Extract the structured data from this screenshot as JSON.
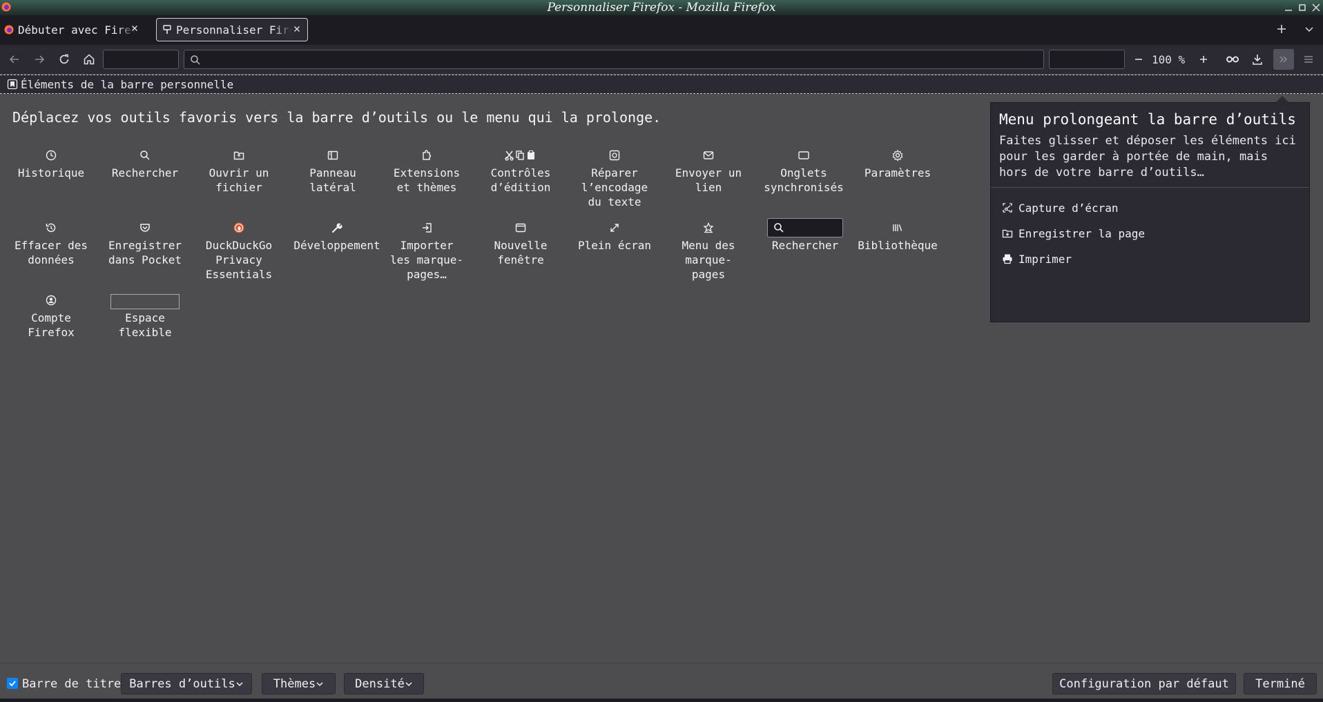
{
  "window": {
    "title": "Personnaliser Firefox - Mozilla Firefox"
  },
  "tabs": [
    {
      "label": "Débuter avec Firefox",
      "selected": false,
      "icon": "firefox-icon"
    },
    {
      "label": "Personnaliser Firefox",
      "selected": true,
      "icon": "customize-icon"
    }
  ],
  "navbar": {
    "zoom": "100 %"
  },
  "bookmarks_toolbar": {
    "label": "Éléments de la barre personnelle"
  },
  "main": {
    "heading": "Déplacez vos outils favoris vers la barre d’outils ou le menu qui la prolonge.",
    "items": [
      {
        "label": "Historique",
        "icon": "history-icon"
      },
      {
        "label": "Rechercher",
        "icon": "search-icon"
      },
      {
        "label": "Ouvrir un\nfichier",
        "icon": "open-file-icon"
      },
      {
        "label": "Panneau\nlatéral",
        "icon": "sidebar-icon"
      },
      {
        "label": "Extensions\net thèmes",
        "icon": "extensions-icon"
      },
      {
        "label": "Contrôles\nd’édition",
        "icon": "edit-controls-icon"
      },
      {
        "label": "Réparer\nl’encodage\ndu texte",
        "icon": "text-encoding-icon"
      },
      {
        "label": "Envoyer un\nlien",
        "icon": "email-link-icon"
      },
      {
        "label": "Onglets\nsynchronisés",
        "icon": "synced-tabs-icon"
      },
      {
        "label": "Paramètres",
        "icon": "gear-icon"
      },
      {
        "label": "Effacer des\ndonnées",
        "icon": "forget-icon"
      },
      {
        "label": "Enregistrer\ndans Pocket",
        "icon": "pocket-icon"
      },
      {
        "label": "DuckDuckGo\nPrivacy\nEssentials",
        "icon": "duckduckgo-icon"
      },
      {
        "label": "Développement",
        "icon": "wrench-icon"
      },
      {
        "label": "Importer\nles marque-\npages…",
        "icon": "import-icon"
      },
      {
        "label": "Nouvelle\nfenêtre",
        "icon": "new-window-icon"
      },
      {
        "label": "Plein écran",
        "icon": "fullscreen-icon"
      },
      {
        "label": "Menu des\nmarque-\npages",
        "icon": "bookmarks-menu-icon"
      },
      {
        "label": "Rechercher",
        "icon": "search-box"
      },
      {
        "label": "Bibliothèque",
        "icon": "library-icon"
      },
      {
        "label": "Compte\nFirefox",
        "icon": "account-icon"
      },
      {
        "label": "Espace\nflexible",
        "icon": "flexible-space"
      }
    ]
  },
  "overflow_panel": {
    "title": "Menu prolongeant la barre d’outils",
    "description": "Faites glisser et déposer les éléments ici pour les garder à portée de main, mais hors de votre barre d’outils…",
    "items": [
      {
        "label": "Capture d’écran",
        "icon": "screenshot-icon"
      },
      {
        "label": "Enregistrer la page",
        "icon": "save-page-icon"
      },
      {
        "label": "Imprimer",
        "icon": "print-icon"
      }
    ]
  },
  "footer": {
    "title_bar_checkbox": "Barre de titre",
    "toolbars_button": "Barres d’outils",
    "themes_button": "Thèmes",
    "density_button": "Densité",
    "restore_defaults": "Configuration par défaut",
    "done": "Terminé"
  }
}
